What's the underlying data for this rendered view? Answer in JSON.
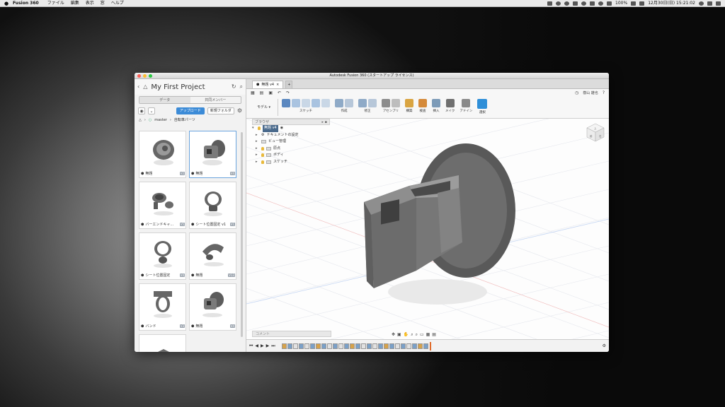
{
  "menubar": {
    "apple": "",
    "app_name": "Fusion 360",
    "menus": [
      "ファイル",
      "編集",
      "表示",
      "窓",
      "ヘルプ"
    ],
    "battery": "100%",
    "datetime": "12月30日(日)  15:21:02"
  },
  "window": {
    "title": "Autodesk Fusion 360 (スタートアップ ライセンス)"
  },
  "data_panel": {
    "project_title": "My First Project",
    "tabs": [
      "データ",
      "共同メンバー"
    ],
    "upload_label": "アップロード",
    "new_folder_label": "新規フォルダ",
    "breadcrumb": [
      "master",
      "自転車パーツ"
    ],
    "items": [
      {
        "name": "無題",
        "version": "V2"
      },
      {
        "name": "無題",
        "version": "V4"
      },
      {
        "name": "バーエンドキャ...",
        "version": "V5"
      },
      {
        "name": "シート位置固定 v1",
        "version": "V1"
      },
      {
        "name": "シート位置固定",
        "version": "V4"
      },
      {
        "name": "無題",
        "version": "V13"
      },
      {
        "name": "バンド",
        "version": "V3"
      },
      {
        "name": "無題",
        "version": "V4"
      },
      {
        "name": "",
        "version": ""
      }
    ]
  },
  "document": {
    "tab_label": "無題 v4",
    "workspace": "モデル",
    "ribbon_groups": [
      "スケッチ",
      "作成",
      "修正",
      "アセンブリ",
      "構築",
      "検査",
      "挿入",
      "メイク",
      "アドイン",
      "選択"
    ],
    "user": "樹山 雄也",
    "browser": {
      "header": "ブラウザ",
      "root": "無題 v4",
      "nodes": [
        "ドキュメントの設定",
        "ビュー管理",
        "原点",
        "ボディ",
        "スケッチ"
      ]
    },
    "comments_label": "コメント",
    "view_cube": {
      "top": "上",
      "front": "前",
      "right": "右"
    }
  },
  "colors": {
    "accent": "#3c8bd7",
    "timeline_marker": "#e06a2a"
  }
}
